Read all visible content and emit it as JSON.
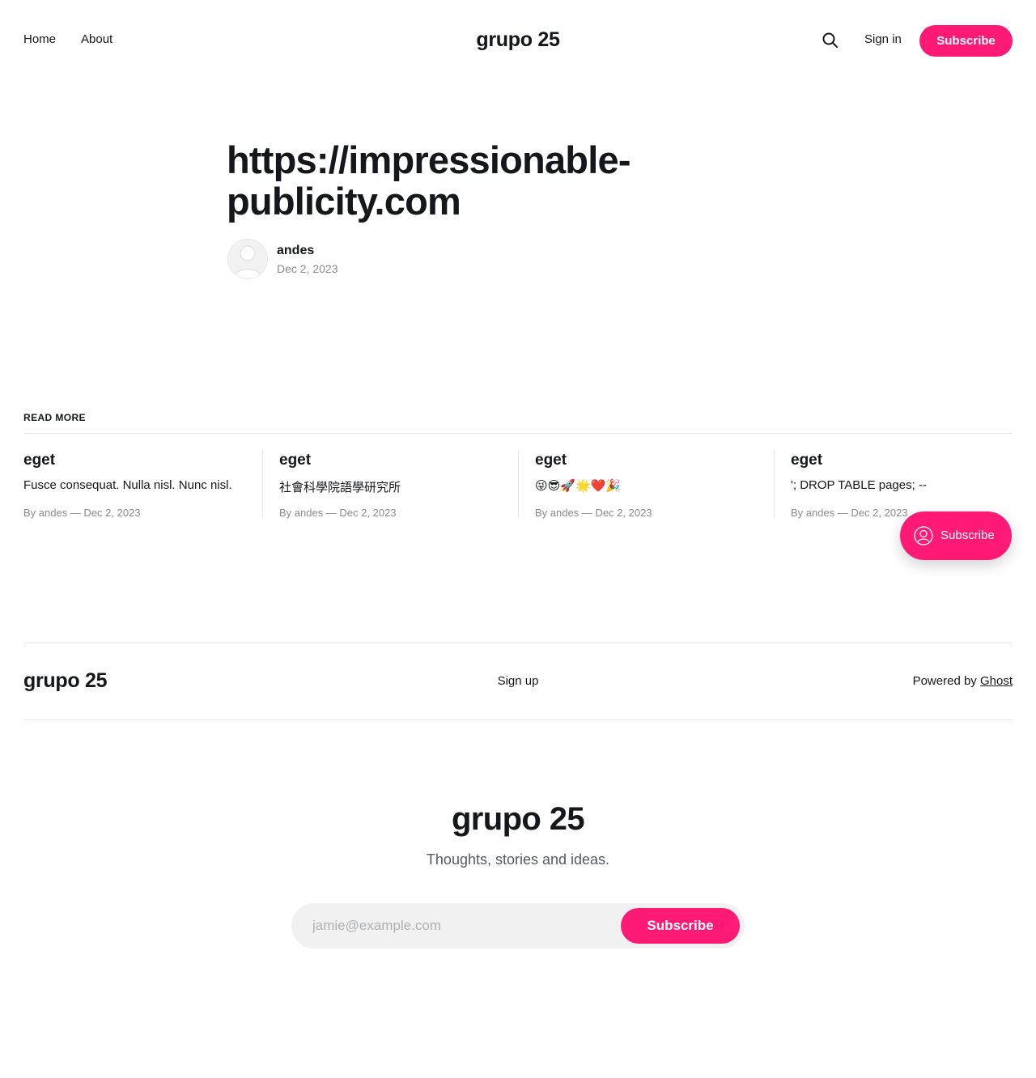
{
  "header": {
    "nav": [
      {
        "label": "Home"
      },
      {
        "label": "About"
      }
    ],
    "site_title": "grupo 25",
    "search_icon": "search-icon",
    "signin_label": "Sign in",
    "subscribe_label": "Subscribe"
  },
  "article": {
    "title": "https://impressionable-publicity.com",
    "author": "andes",
    "date": "Dec 2, 2023",
    "avatar_icon": "avatar-placeholder-icon"
  },
  "read_more": {
    "label": "READ MORE",
    "cards": [
      {
        "title": "eget",
        "excerpt": "Fusce consequat. Nulla nisl. Nunc nisl.",
        "meta": "By andes — Dec 2, 2023"
      },
      {
        "title": "eget",
        "excerpt": "社會科學院語學研究所",
        "meta": "By andes — Dec 2, 2023"
      },
      {
        "title": "eget",
        "excerpt": "😜😎🚀🌟❤️🎉",
        "meta": "By andes — Dec 2, 2023"
      },
      {
        "title": "eget",
        "excerpt": "'; DROP TABLE pages; --",
        "meta": "By andes — Dec 2, 2023"
      }
    ]
  },
  "portal": {
    "label": "Subscribe",
    "icon": "user-circle-icon"
  },
  "footer": {
    "site_title": "grupo 25",
    "signup_label": "Sign up",
    "powered_prefix": "Powered by",
    "powered_link": "Ghost"
  },
  "cta": {
    "title": "grupo 25",
    "description": "Thoughts, stories and ideas.",
    "email_placeholder": "jamie@example.com",
    "button_label": "Subscribe"
  },
  "colors": {
    "accent": "#ff1a75",
    "text": "#15171a",
    "muted": "#8a8a8a"
  }
}
